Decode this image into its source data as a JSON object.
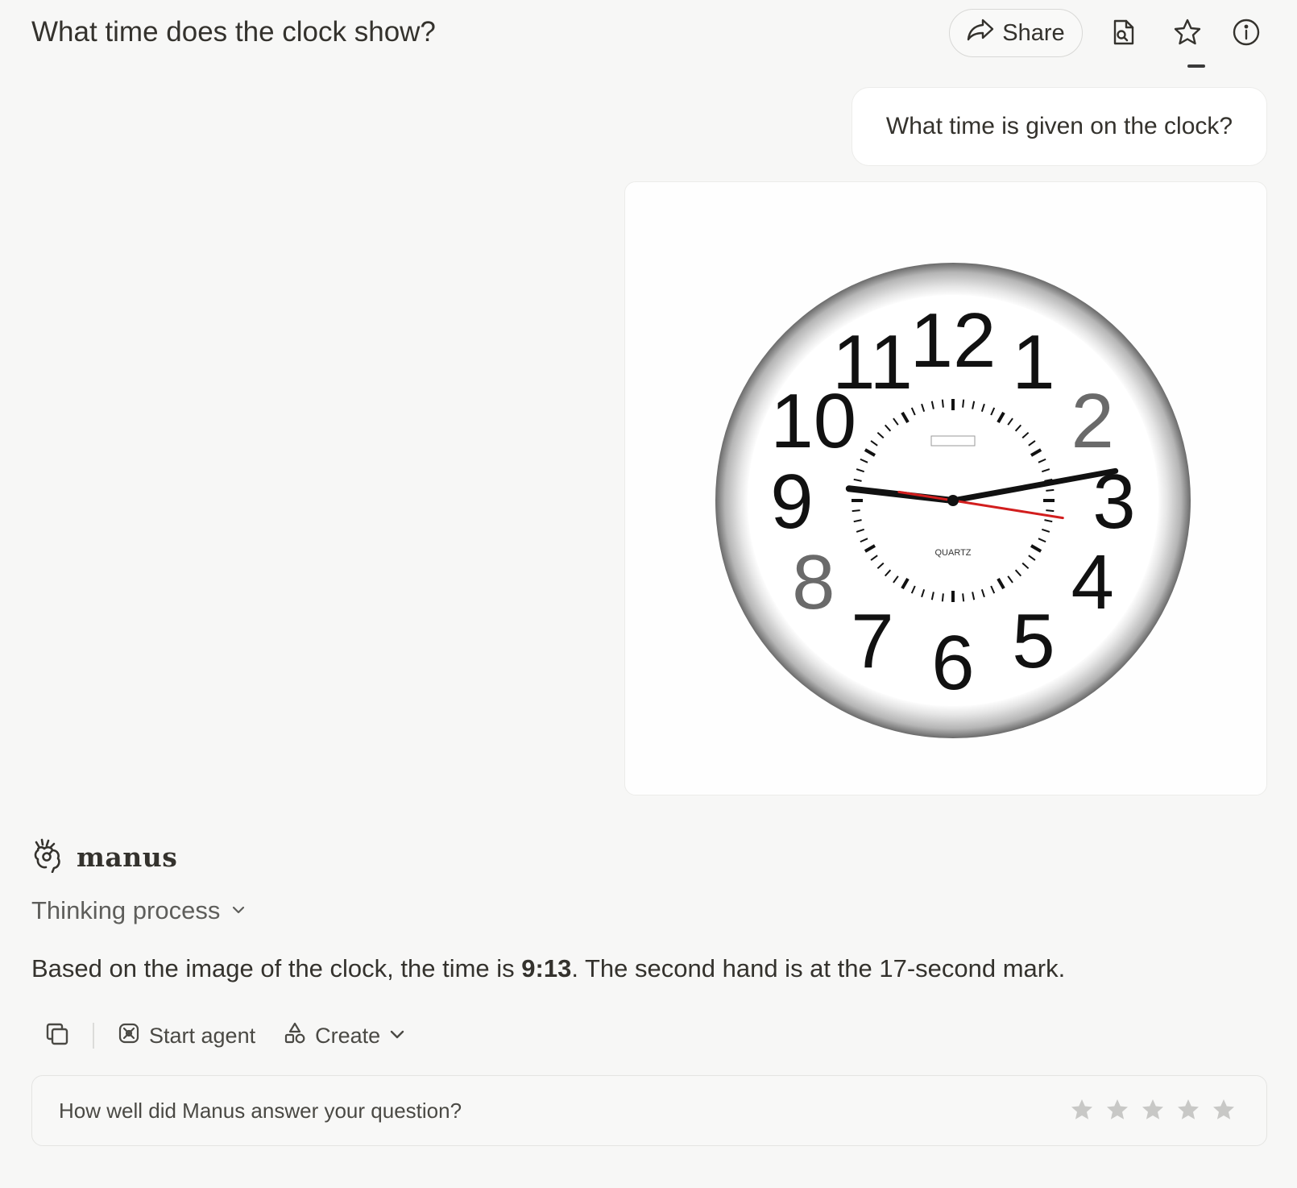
{
  "header": {
    "title": "What time does the clock show?",
    "share_label": "Share",
    "icons": [
      "share-icon",
      "file-search-icon",
      "star-icon",
      "info-icon"
    ]
  },
  "conversation": {
    "user_message": "What time is given on the clock?",
    "image_content": {
      "clock_numerals": [
        "12",
        "1",
        "2",
        "3",
        "4",
        "5",
        "6",
        "7",
        "8",
        "9",
        "10",
        "11"
      ],
      "hour": 9,
      "minute": 13,
      "second": 17
    }
  },
  "assistant": {
    "brand_name": "manus",
    "thinking_label": "Thinking process",
    "answer_prefix": "Based on the image of the clock, the time is ",
    "answer_time": "9:13",
    "answer_suffix": ". The second hand is at the 17-second mark."
  },
  "actions": {
    "start_agent_label": "Start agent",
    "create_label": "Create"
  },
  "feedback": {
    "question": "How well did Manus answer your question?",
    "stars": [
      1,
      2,
      3,
      4,
      5
    ],
    "rating": 0
  },
  "colors": {
    "background": "#f7f7f6",
    "text": "#34322d",
    "second_hand": "#d21e1e",
    "star_inactive": "#c8c8c6"
  }
}
